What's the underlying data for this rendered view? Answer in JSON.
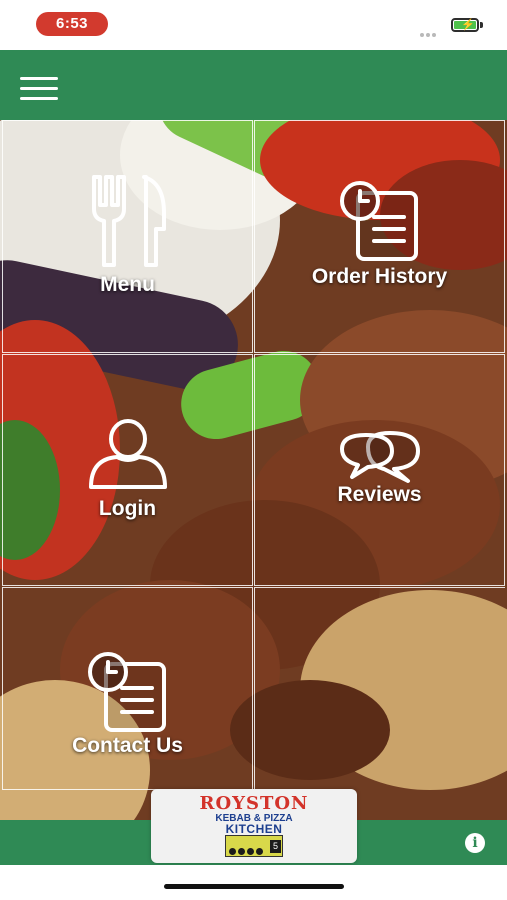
{
  "status_bar": {
    "time": "6:53"
  },
  "tiles": [
    {
      "id": "menu",
      "label": "Menu",
      "icon": "fork-knife-icon"
    },
    {
      "id": "order_history",
      "label": "Order History",
      "icon": "order-history-icon"
    },
    {
      "id": "login",
      "label": "Login",
      "icon": "user-icon"
    },
    {
      "id": "reviews",
      "label": "Reviews",
      "icon": "chat-bubbles-icon"
    },
    {
      "id": "contact_us",
      "label": "Contact Us",
      "icon": "contact-clipboard-icon"
    }
  ],
  "footer": {
    "logo": {
      "title": "ROYSTON",
      "subtitle": "KEBAB & PIZZA",
      "kitchen": "KITCHEN",
      "hygiene_rating": "5"
    },
    "info_icon": "info-icon"
  },
  "colors": {
    "header_green": "#2f8a55",
    "time_pill": "#d23a2e",
    "battery": "#4ec04a"
  }
}
